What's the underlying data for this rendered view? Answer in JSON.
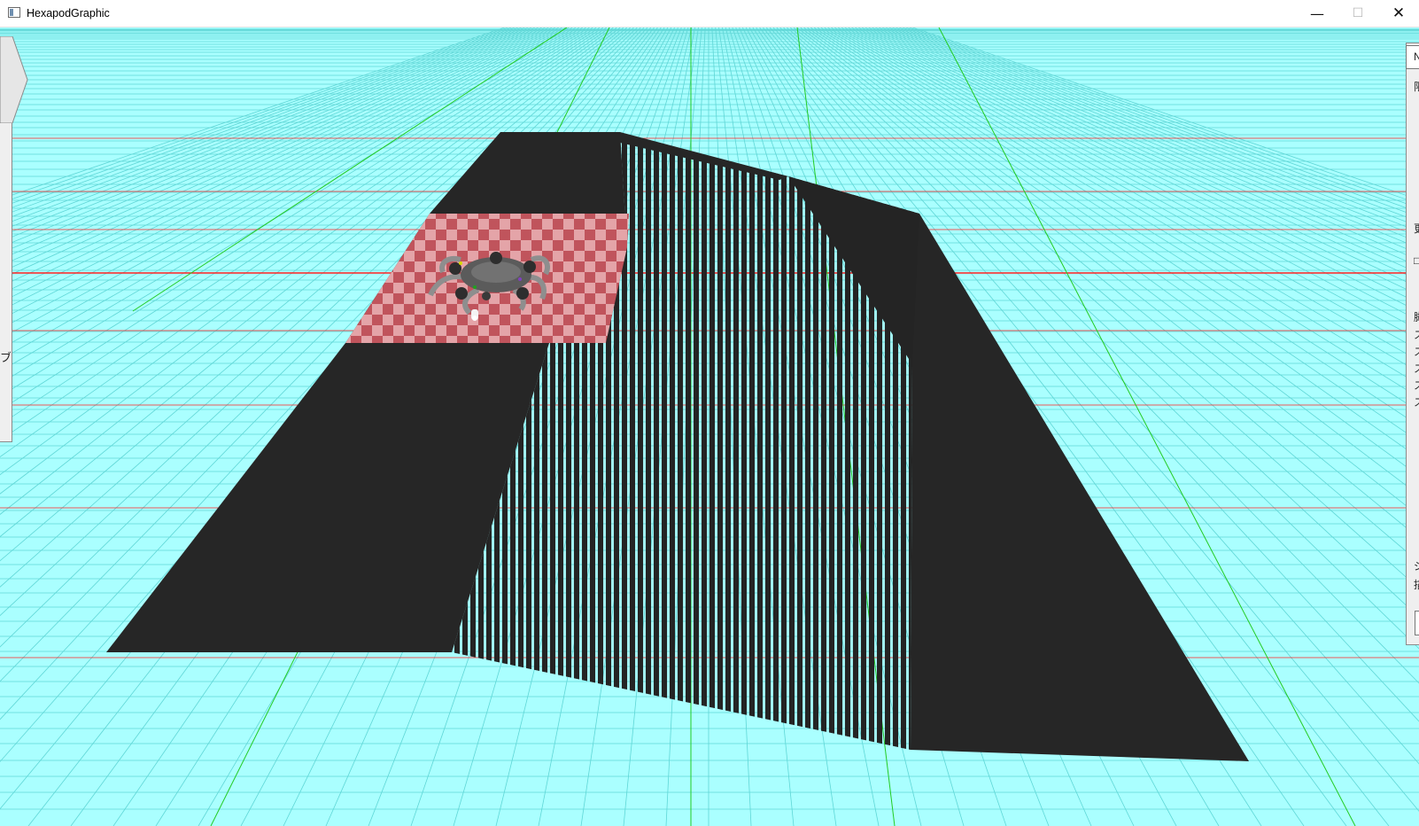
{
  "window": {
    "title": "HexapodGraphic",
    "controls": {
      "minimize": "—",
      "maximize": "☐",
      "close": "✕"
    }
  },
  "scene": {
    "background_color": "#aaffff",
    "grid_color": "#5fd6d6",
    "axis_x_color": "#ff2020",
    "axis_y_color": "#22cc22",
    "terrain_color": "#262626",
    "checker_colors": [
      "#c0545c",
      "#e4a4a8"
    ],
    "robot": "hexapod"
  },
  "left_panel": {
    "visible_text": "ブ"
  },
  "right_panel": {
    "visible_text": [
      "N",
      "限",
      "更",
      "□",
      "脚",
      "ス",
      "ス",
      "ス",
      "ス",
      "ス",
      "ジ",
      "描"
    ]
  }
}
